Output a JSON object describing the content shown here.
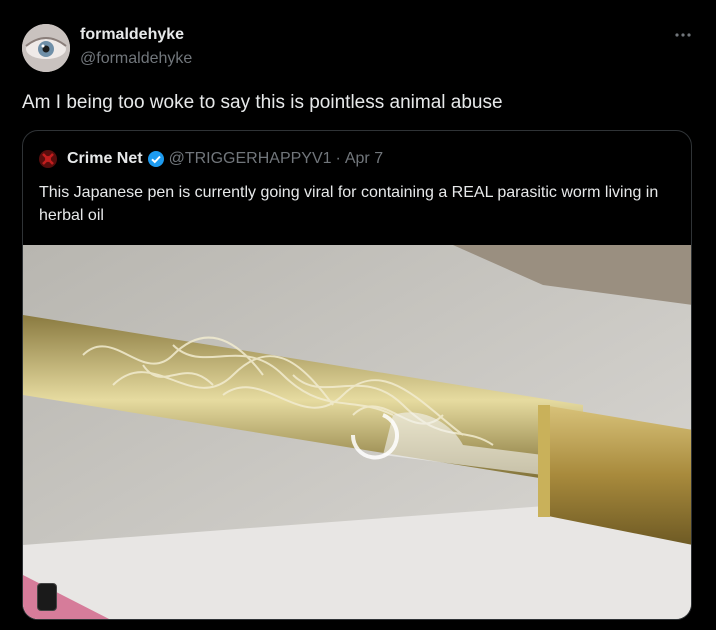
{
  "post": {
    "author_name": "formaldehyke",
    "author_handle": "@formaldehyke",
    "text": "Am I being too woke to say this is pointless animal abuse",
    "more_icon": "more-horizontal-icon"
  },
  "quote": {
    "name": "Crime Net",
    "handle": "@TRIGGERHAPPYV1",
    "separator": "·",
    "date": "Apr 7",
    "text": "This Japanese pen is currently going viral for containing a REAL parasitic worm living in herbal oil",
    "logo_icon": "crime-net-logo-icon",
    "verified_icon": "verified-badge-icon"
  },
  "colors": {
    "background": "#000000",
    "text_primary": "#e7e9ea",
    "text_secondary": "#71767b",
    "border": "#2f3336",
    "verified": "#1d9bf0"
  }
}
